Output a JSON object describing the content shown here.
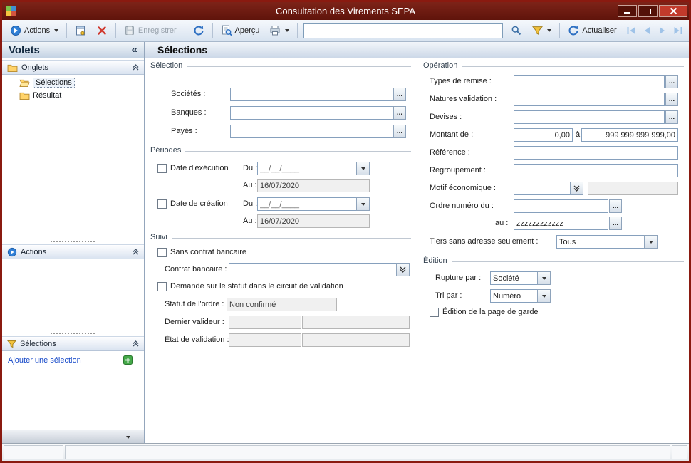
{
  "window": {
    "title": "Consultation des Virements SEPA"
  },
  "ui": {
    "browse": "..."
  },
  "toolbar": {
    "actions": "Actions",
    "enregistrer": "Enregistrer",
    "apercu": "Aperçu",
    "actualiser": "Actualiser",
    "search_value": ""
  },
  "sidebar": {
    "title": "Volets",
    "collapse": "«",
    "onglets": "Onglets",
    "tree": [
      {
        "label": "Sélections"
      },
      {
        "label": "Résultat"
      }
    ],
    "actions": "Actions",
    "selections": "Sélections",
    "add_selection": "Ajouter une sélection"
  },
  "main": {
    "title": "Sélections",
    "selection": {
      "title": "Sélection",
      "societes": "Sociétés :",
      "banques": "Banques :",
      "payes": "Payés :"
    },
    "periodes": {
      "title": "Périodes",
      "date_execution": "Date d'exécution",
      "date_creation": "Date de création",
      "du": "Du :",
      "au": "Au :",
      "du_value": "__/__/____",
      "au_value": "16/07/2020"
    },
    "suivi": {
      "title": "Suivi",
      "sans_contrat": "Sans contrat bancaire",
      "contrat": "Contrat bancaire :",
      "demande_statut": "Demande sur le statut dans le circuit de validation",
      "statut": "Statut de l'ordre :",
      "statut_value": "Non confirmé",
      "dernier_valideur": "Dernier valideur :",
      "etat_validation": "État de validation :"
    },
    "operation": {
      "title": "Opération",
      "types_remise": "Types de remise :",
      "natures_validation": "Natures validation :",
      "devises": "Devises :",
      "montant_de": "Montant de :",
      "montant_de_value": "0,00",
      "a": "à",
      "montant_a_value": "999 999 999 999,00",
      "reference": "Référence :",
      "regroupement": "Regroupement :",
      "motif": "Motif économique :",
      "ordre_du": "Ordre numéro du :",
      "ordre_au": "au :",
      "ordre_au_value": "zzzzzzzzzzzz",
      "tiers": "Tiers sans adresse seulement :",
      "tiers_value": "Tous"
    },
    "edition": {
      "title": "Édition",
      "rupture": "Rupture par :",
      "rupture_value": "Société",
      "tri": "Tri par :",
      "tri_value": "Numéro",
      "page_garde": "Édition de la page de garde"
    }
  }
}
